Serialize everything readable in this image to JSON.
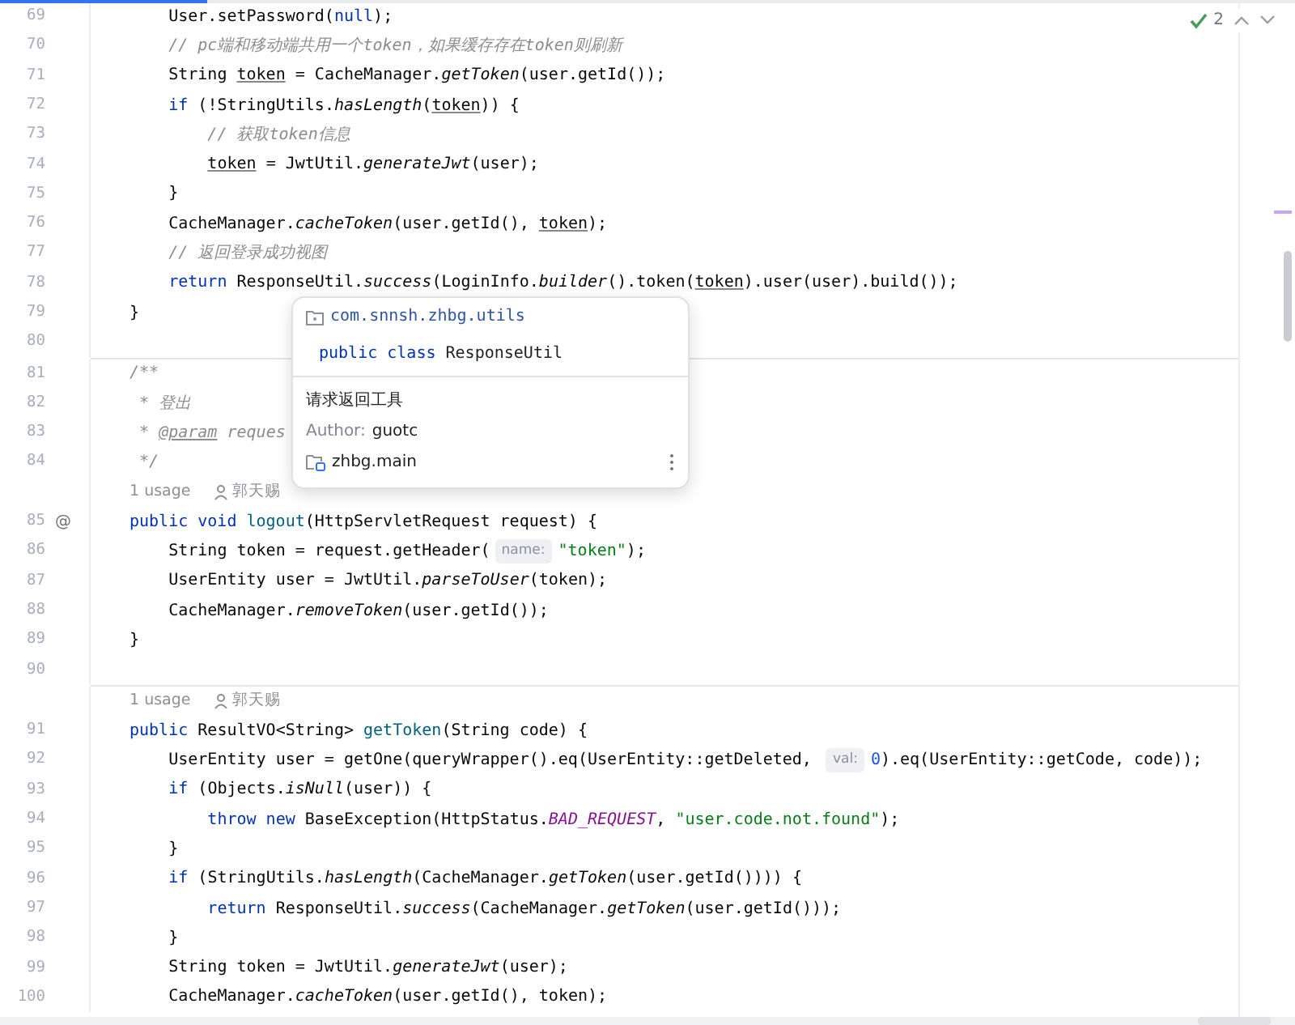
{
  "progress": {
    "level": 0.16
  },
  "inspections": {
    "count": "2"
  },
  "lines": [
    {
      "kind": "code",
      "number": "69",
      "tokens": [
        {
          "t": "    User.setPassword(",
          "kind": "plain"
        },
        {
          "t": "null",
          "kind": "keyword"
        },
        {
          "t": ");",
          "kind": "plain"
        }
      ]
    },
    {
      "kind": "code",
      "number": "70",
      "tokens": [
        {
          "t": "    // pc端和移动端共用一个token，如果缓存存在token则刷新",
          "kind": "comment"
        }
      ]
    },
    {
      "kind": "code",
      "number": "71",
      "tokens": [
        {
          "t": "    String ",
          "kind": "plain"
        },
        {
          "t": "token",
          "kind": "var"
        },
        {
          "t": " = CacheManager.",
          "kind": "plain"
        },
        {
          "t": "getToken",
          "kind": "static"
        },
        {
          "t": "(user.getId());",
          "kind": "plain"
        }
      ]
    },
    {
      "kind": "code",
      "number": "72",
      "tokens": [
        {
          "t": "    if",
          "kind": "keyword"
        },
        {
          "t": " (!StringUtils.",
          "kind": "plain"
        },
        {
          "t": "hasLength",
          "kind": "static"
        },
        {
          "t": "(",
          "kind": "plain"
        },
        {
          "t": "token",
          "kind": "var"
        },
        {
          "t": ")) {",
          "kind": "plain"
        }
      ]
    },
    {
      "kind": "code",
      "number": "73",
      "tokens": [
        {
          "t": "        // 获取token信息",
          "kind": "comment"
        }
      ]
    },
    {
      "kind": "code",
      "number": "74",
      "tokens": [
        {
          "t": "        token",
          "kind": "var"
        },
        {
          "t": " = JwtUtil.",
          "kind": "plain"
        },
        {
          "t": "generateJwt",
          "kind": "static"
        },
        {
          "t": "(user);",
          "kind": "plain"
        }
      ]
    },
    {
      "kind": "code",
      "number": "75",
      "tokens": [
        {
          "t": "    }",
          "kind": "plain"
        }
      ]
    },
    {
      "kind": "code",
      "number": "76",
      "tokens": [
        {
          "t": "    CacheManager.",
          "kind": "plain"
        },
        {
          "t": "cacheToken",
          "kind": "static"
        },
        {
          "t": "(user.getId(), ",
          "kind": "plain"
        },
        {
          "t": "token",
          "kind": "var"
        },
        {
          "t": ");",
          "kind": "plain"
        }
      ]
    },
    {
      "kind": "code",
      "number": "77",
      "tokens": [
        {
          "t": "    // 返回登录成功视图",
          "kind": "comment"
        }
      ]
    },
    {
      "kind": "code",
      "number": "78",
      "tokens": [
        {
          "t": "    return",
          "kind": "keyword"
        },
        {
          "t": " ResponseUtil.",
          "kind": "plain"
        },
        {
          "t": "success",
          "kind": "static"
        },
        {
          "t": "(LoginInfo.",
          "kind": "plain"
        },
        {
          "t": "builder",
          "kind": "static"
        },
        {
          "t": "().token(",
          "kind": "plain"
        },
        {
          "t": "token",
          "kind": "var"
        },
        {
          "t": ").user(user).build());",
          "kind": "plain"
        }
      ]
    },
    {
      "kind": "code",
      "number": "79",
      "tokens": [
        {
          "t": "}",
          "kind": "plain"
        }
      ]
    },
    {
      "kind": "code",
      "number": "80"
    },
    {
      "kind": "code",
      "number": "81",
      "separator": true,
      "tokens": [
        {
          "t": "/**",
          "kind": "doc"
        }
      ]
    },
    {
      "kind": "code",
      "number": "82",
      "tokens": [
        {
          "t": " * 登出",
          "kind": "doc"
        }
      ]
    },
    {
      "kind": "code",
      "number": "83",
      "tokens": [
        {
          "t": " * ",
          "kind": "doc"
        },
        {
          "t": "@param",
          "kind": "doctag"
        },
        {
          "t": " reques",
          "kind": "doc"
        }
      ]
    },
    {
      "kind": "code",
      "number": "84",
      "tokens": [
        {
          "t": " */",
          "kind": "doc"
        }
      ]
    },
    {
      "kind": "usage",
      "usages": "1 usage",
      "author": "郭天赐"
    },
    {
      "kind": "code",
      "number": "85",
      "marker": "@",
      "tokens": [
        {
          "t": "public void ",
          "kind": "keyword"
        },
        {
          "t": "logout",
          "kind": "decl"
        },
        {
          "t": "(HttpServletRequest request) {",
          "kind": "plain"
        }
      ]
    },
    {
      "kind": "code",
      "number": "86",
      "tokens": [
        {
          "t": "    String token = request.getHeader(",
          "kind": "plain"
        },
        {
          "t": "name:",
          "kind": "hint"
        },
        {
          "t": "\"token\"",
          "kind": "string"
        },
        {
          "t": ");",
          "kind": "plain"
        }
      ]
    },
    {
      "kind": "code",
      "number": "87",
      "tokens": [
        {
          "t": "    UserEntity user = JwtUtil.",
          "kind": "plain"
        },
        {
          "t": "parseToUser",
          "kind": "static"
        },
        {
          "t": "(token);",
          "kind": "plain"
        }
      ]
    },
    {
      "kind": "code",
      "number": "88",
      "tokens": [
        {
          "t": "    CacheManager.",
          "kind": "plain"
        },
        {
          "t": "removeToken",
          "kind": "static"
        },
        {
          "t": "(user.getId());",
          "kind": "plain"
        }
      ]
    },
    {
      "kind": "code",
      "number": "89",
      "tokens": [
        {
          "t": "}",
          "kind": "plain"
        }
      ]
    },
    {
      "kind": "code",
      "number": "90"
    },
    {
      "kind": "usage",
      "separator": true,
      "usages": "1 usage",
      "author": "郭天赐"
    },
    {
      "kind": "code",
      "number": "91",
      "tokens": [
        {
          "t": "public",
          "kind": "keyword"
        },
        {
          "t": " ResultVO<String> ",
          "kind": "plain"
        },
        {
          "t": "getToken",
          "kind": "decl"
        },
        {
          "t": "(String code) {",
          "kind": "plain"
        }
      ]
    },
    {
      "kind": "code",
      "number": "92",
      "tokens": [
        {
          "t": "    UserEntity user = getOne(queryWrapper().eq(UserEntity::getDeleted, ",
          "kind": "plain"
        },
        {
          "t": "val:",
          "kind": "hint"
        },
        {
          "t": "0",
          "kind": "number"
        },
        {
          "t": ").eq(UserEntity::getCode, code));",
          "kind": "plain"
        }
      ]
    },
    {
      "kind": "code",
      "number": "93",
      "tokens": [
        {
          "t": "    if",
          "kind": "keyword"
        },
        {
          "t": " (Objects.",
          "kind": "plain"
        },
        {
          "t": "isNull",
          "kind": "static"
        },
        {
          "t": "(user)) {",
          "kind": "plain"
        }
      ]
    },
    {
      "kind": "code",
      "number": "94",
      "tokens": [
        {
          "t": "        throw new",
          "kind": "keyword"
        },
        {
          "t": " BaseException(HttpStatus.",
          "kind": "plain"
        },
        {
          "t": "BAD_REQUEST",
          "kind": "const"
        },
        {
          "t": ", ",
          "kind": "plain"
        },
        {
          "t": "\"user.code.not.found\"",
          "kind": "string"
        },
        {
          "t": ");",
          "kind": "plain"
        }
      ]
    },
    {
      "kind": "code",
      "number": "95",
      "tokens": [
        {
          "t": "    }",
          "kind": "plain"
        }
      ]
    },
    {
      "kind": "code",
      "number": "96",
      "tokens": [
        {
          "t": "    if",
          "kind": "keyword"
        },
        {
          "t": " (StringUtils.",
          "kind": "plain"
        },
        {
          "t": "hasLength",
          "kind": "static"
        },
        {
          "t": "(CacheManager.",
          "kind": "plain"
        },
        {
          "t": "getToken",
          "kind": "static"
        },
        {
          "t": "(user.getId()))) {",
          "kind": "plain"
        }
      ]
    },
    {
      "kind": "code",
      "number": "97",
      "tokens": [
        {
          "t": "        return",
          "kind": "keyword"
        },
        {
          "t": " ResponseUtil.",
          "kind": "plain"
        },
        {
          "t": "success",
          "kind": "static"
        },
        {
          "t": "(CacheManager.",
          "kind": "plain"
        },
        {
          "t": "getToken",
          "kind": "static"
        },
        {
          "t": "(user.getId()));",
          "kind": "plain"
        }
      ]
    },
    {
      "kind": "code",
      "number": "98",
      "tokens": [
        {
          "t": "    }",
          "kind": "plain"
        }
      ]
    },
    {
      "kind": "code",
      "number": "99",
      "tokens": [
        {
          "t": "    String token = JwtUtil.",
          "kind": "plain"
        },
        {
          "t": "generateJwt",
          "kind": "static"
        },
        {
          "t": "(user);",
          "kind": "plain"
        }
      ]
    },
    {
      "kind": "code",
      "number": "100",
      "tokens": [
        {
          "t": "    CacheManager.",
          "kind": "plain"
        },
        {
          "t": "cacheToken",
          "kind": "static"
        },
        {
          "t": "(user.getId(), token);",
          "kind": "plain"
        }
      ]
    }
  ],
  "popup": {
    "package": "com.snnsh.zhbg.utils",
    "signature": [
      {
        "t": "public class",
        "kind": "keyword"
      },
      {
        "t": " ResponseUtil",
        "kind": "plain"
      }
    ],
    "description": "请求返回工具",
    "author_label": "Author:",
    "author": "guotc",
    "module": "zhbg.main"
  }
}
